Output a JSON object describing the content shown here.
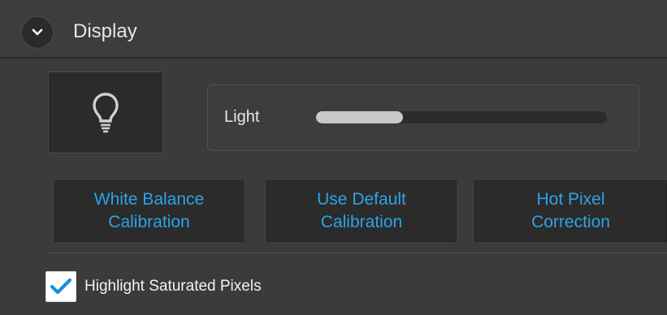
{
  "section": {
    "title": "Display",
    "collapse_icon": "chevron-down-icon"
  },
  "light": {
    "toggle_icon": "lightbulb-icon",
    "label": "Light",
    "level_percent": 30
  },
  "buttons": [
    {
      "label": "White Balance\nCalibration"
    },
    {
      "label": "Use Default\nCalibration"
    },
    {
      "label": "Hot Pixel\nCorrection"
    }
  ],
  "highlight": {
    "label": "Highlight Saturated Pixels",
    "checked": true,
    "check_color": "#1a8fe0"
  },
  "colors": {
    "accent": "#2ca3e8",
    "panel_bg": "#3b3b3b"
  }
}
